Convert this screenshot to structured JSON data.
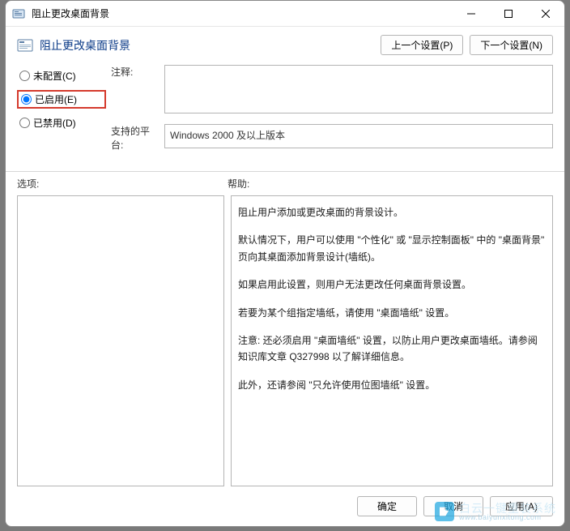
{
  "window": {
    "title": "阻止更改桌面背景"
  },
  "header": {
    "title": "阻止更改桌面背景",
    "prev": "上一个设置(P)",
    "next": "下一个设置(N)"
  },
  "radios": {
    "not_configured": "未配置(C)",
    "enabled": "已启用(E)",
    "disabled": "已禁用(D)",
    "selected": "enabled"
  },
  "labels": {
    "comment": "注释:",
    "platform": "支持的平台:",
    "options": "选项:",
    "help": "帮助:"
  },
  "fields": {
    "comment": "",
    "platform": "Windows 2000 及以上版本"
  },
  "help_paragraphs": [
    "阻止用户添加或更改桌面的背景设计。",
    "默认情况下，用户可以使用 \"个性化\" 或 \"显示控制面板\" 中的 \"桌面背景\" 页向其桌面添加背景设计(墙纸)。",
    "如果启用此设置，则用户无法更改任何桌面背景设置。",
    "若要为某个组指定墙纸，请使用 \"桌面墙纸\" 设置。",
    "注意: 还必须启用 \"桌面墙纸\" 设置，以防止用户更改桌面墙纸。请参阅知识库文章 Q327998 以了解详细信息。",
    "此外，还请参阅 \"只允许使用位图墙纸\" 设置。"
  ],
  "buttons": {
    "ok": "确定",
    "cancel": "取消",
    "apply": "应用(A)"
  },
  "watermark": {
    "line1": "白云一键重装系统",
    "line2": "www.baiyunxitong.com"
  }
}
